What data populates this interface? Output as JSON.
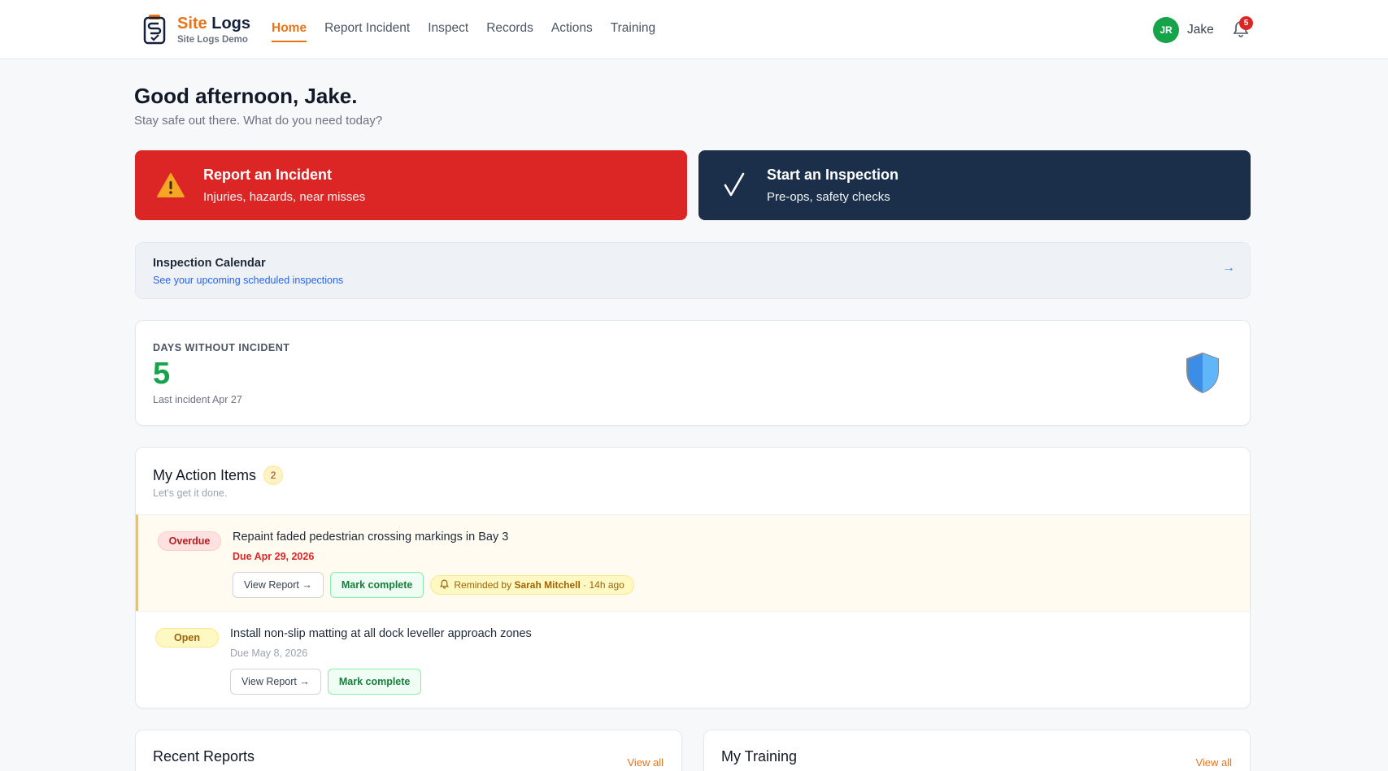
{
  "brand": {
    "name_part1": "Site",
    "name_part2": "Logs",
    "subtitle": "Site Logs Demo"
  },
  "nav": {
    "items": [
      {
        "label": "Home",
        "active": true
      },
      {
        "label": "Report Incident"
      },
      {
        "label": "Inspect"
      },
      {
        "label": "Records"
      },
      {
        "label": "Actions"
      },
      {
        "label": "Training"
      }
    ]
  },
  "user": {
    "initials": "JR",
    "name": "Jake",
    "notification_count": "5"
  },
  "greeting": {
    "title": "Good afternoon, Jake.",
    "subtitle": "Stay safe out there. What do you need today?"
  },
  "hero": {
    "report": {
      "title": "Report an Incident",
      "subtitle": "Injuries, hazards, near misses",
      "color": "#dc2626",
      "icon": "warning-icon"
    },
    "inspect": {
      "title": "Start an Inspection",
      "subtitle": "Pre-ops, safety checks",
      "color": "#1b2f4b",
      "icon": "checkmark-icon"
    }
  },
  "calendar": {
    "title": "Inspection Calendar",
    "subtitle": "See your upcoming scheduled inspections",
    "arrow": "→"
  },
  "days": {
    "label": "DAYS WITHOUT INCIDENT",
    "value": "5",
    "last": "Last incident Apr 27",
    "icon": "shield-icon"
  },
  "action_items": {
    "title": "My Action Items",
    "count": "2",
    "subtitle": "Let's get it done.",
    "items": [
      {
        "status": "Overdue",
        "title": "Repaint faded pedestrian crossing markings in Bay 3",
        "due": "Due Apr 29, 2026",
        "view_label": "View Report →",
        "complete_label": "Mark complete",
        "reminder_prefix": "Reminded by",
        "reminder_by": "Sarah Mitchell",
        "reminder_time": "· 14h ago"
      },
      {
        "status": "Open",
        "title": "Install non-slip matting at all dock leveller approach zones",
        "due": "Due May 8, 2026",
        "view_label": "View Report →",
        "complete_label": "Mark complete"
      }
    ]
  },
  "recent_reports": {
    "title": "Recent Reports",
    "view_all": "View all"
  },
  "my_training": {
    "title": "My Training",
    "view_all": "View all"
  },
  "colors": {
    "accent": "#ea7415",
    "success": "#16a34a",
    "danger": "#dc2626",
    "navy": "#1b2f4b"
  }
}
